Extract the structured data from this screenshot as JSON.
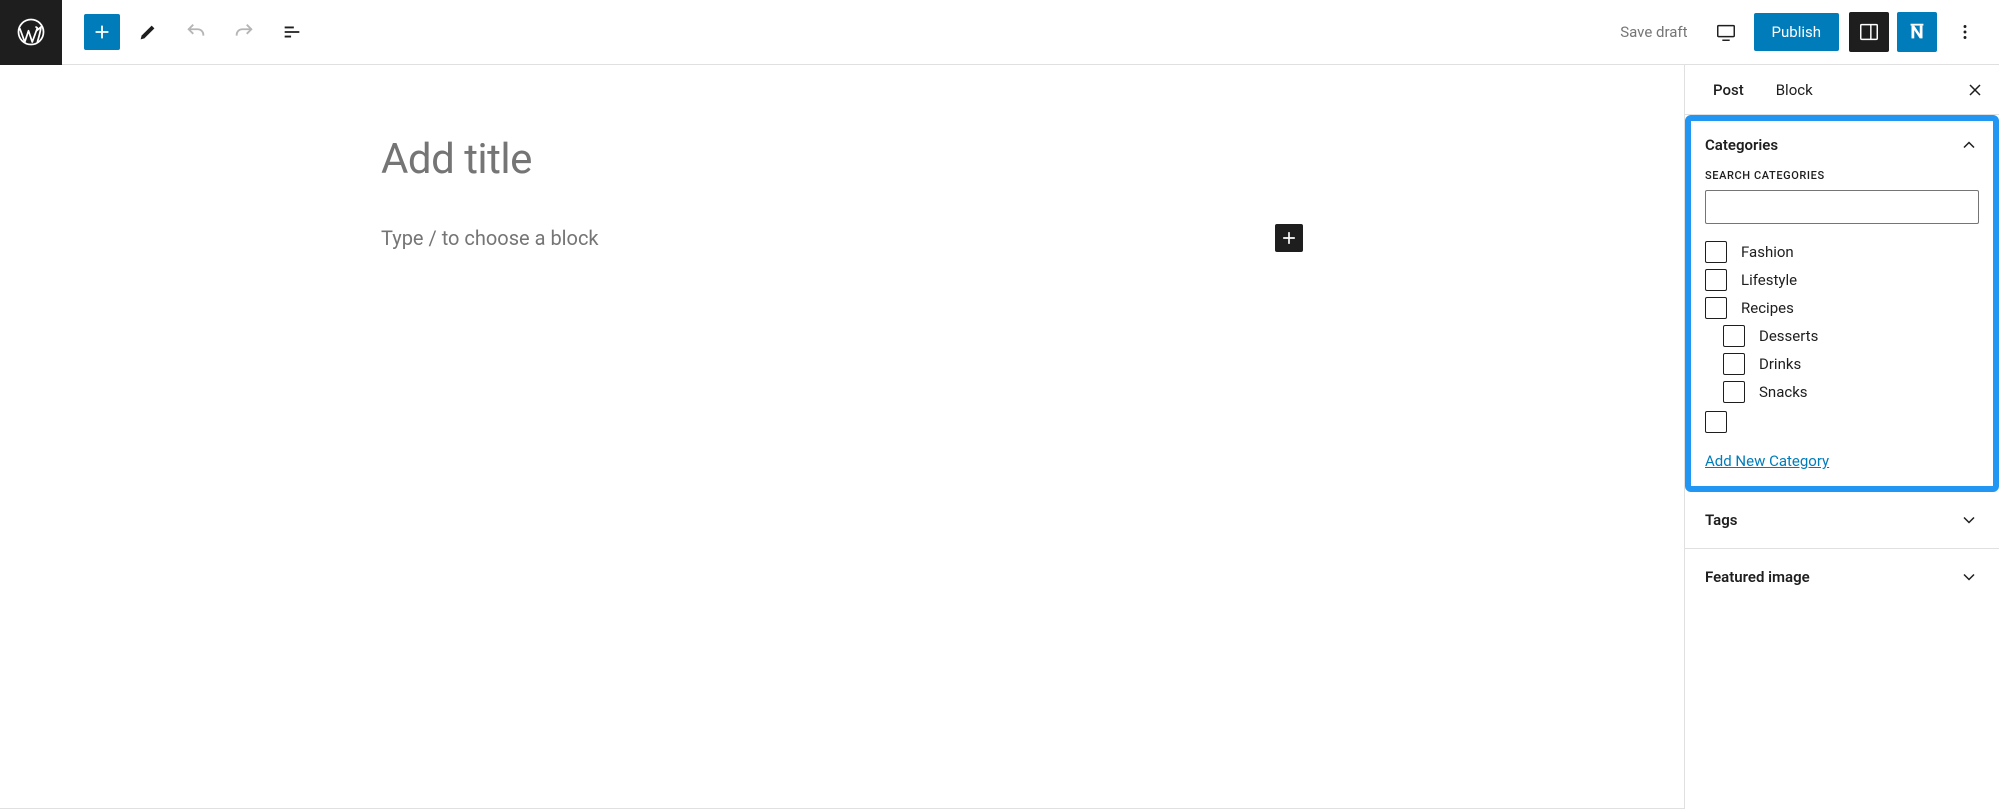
{
  "topbar": {
    "save_draft": "Save draft",
    "publish": "Publish"
  },
  "editor": {
    "title_placeholder": "Add title",
    "block_placeholder": "Type / to choose a block"
  },
  "sidebar": {
    "tabs": {
      "post": "Post",
      "block": "Block"
    },
    "categories": {
      "title": "Categories",
      "search_label": "SEARCH CATEGORIES",
      "add_new": "Add New Category",
      "items": [
        {
          "label": "Fashion"
        },
        {
          "label": "Lifestyle"
        },
        {
          "label": "Recipes"
        },
        {
          "label": "Desserts"
        },
        {
          "label": "Drinks"
        },
        {
          "label": "Snacks"
        }
      ]
    },
    "tags": {
      "title": "Tags"
    },
    "featured": {
      "title": "Featured image"
    }
  }
}
